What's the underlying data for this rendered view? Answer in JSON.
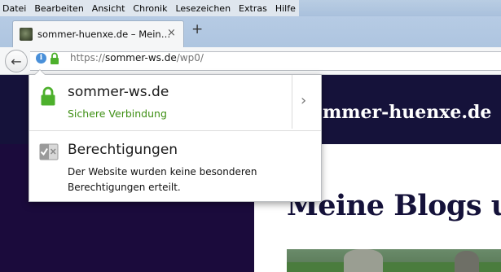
{
  "menu": {
    "items": [
      {
        "label": "Datei"
      },
      {
        "label": "Bearbeiten"
      },
      {
        "label": "Ansicht"
      },
      {
        "label": "Chronik"
      },
      {
        "label": "Lesezeichen"
      },
      {
        "label": "Extras"
      },
      {
        "label": "Hilfe"
      }
    ]
  },
  "tab": {
    "title": "sommer-huenxe.de – Mein…",
    "close_icon": "×",
    "favicon": "site-favicon"
  },
  "new_tab_icon": "+",
  "nav": {
    "back_icon": "←",
    "info_icon": "i",
    "url_scheme": "https://",
    "url_host": "sommer-ws.de",
    "url_path": "/wp0/"
  },
  "page": {
    "site_title": "mmer-huenxe.de",
    "blog_heading": "Meine Blogs u"
  },
  "popup": {
    "host": "sommer-ws.de",
    "secure_label": "Sichere Verbindung",
    "chevron": "›",
    "permissions_title": "Berechtigungen",
    "permissions_desc": "Der Website wurden keine besonderen Berechtigungen erteilt."
  },
  "colors": {
    "secure_green": "#3e8f14",
    "lock_green": "#4db02c",
    "page_header": "#15123a",
    "page_sidebar": "#1b0b3c",
    "info_blue": "#4a90d9"
  }
}
